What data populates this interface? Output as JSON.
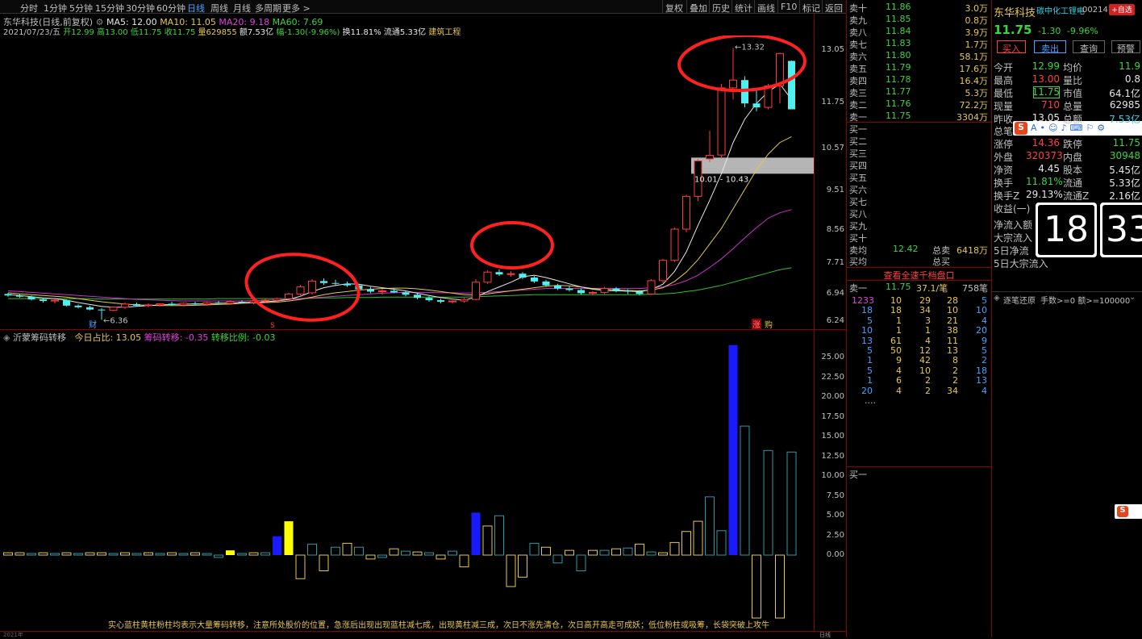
{
  "toolbar": {
    "periods": [
      "分时",
      "1分钟",
      "5分钟",
      "15分钟",
      "30分钟",
      "60分钟",
      "日线",
      "周线",
      "月线",
      "多周期",
      "更多 >"
    ],
    "active_period": "日线",
    "buttons": [
      "复权",
      "叠加",
      "历史",
      "统计",
      "画线",
      "F10",
      "标记",
      "返回"
    ]
  },
  "info": {
    "stock_line": "东华科技(日线,前复权)",
    "ma5": "MA5: 12.00",
    "ma10": "MA10: 11.05",
    "ma20": "MA20: 9.18",
    "ma60": "MA60: 7.69",
    "date": "2021/07/23/五",
    "open": "开12.99",
    "high": "高13.00",
    "low": "低11.75",
    "close": "收11.75",
    "volume": "量629855",
    "amount": "额7.53亿",
    "change": "幅-1.30(-9.96%)",
    "turnover": "换11.81%",
    "float": "流通5.33亿",
    "sector": "建筑工程"
  },
  "kchart": {
    "labels": {
      "high": "13.32",
      "low": "6.36",
      "range": "10.01 - 10.43",
      "cai": "财",
      "s": "S",
      "zhang": "涨",
      "gou": "购"
    },
    "yticks": [
      "13.05",
      "11.75",
      "10.57",
      "9.51",
      "8.56",
      "7.71",
      "6.94",
      "6.24"
    ]
  },
  "indicator": {
    "name": "沂蒙筹码转移",
    "today": "今日占比: 13.05",
    "shift": "筹码转移: -0.35",
    "ratio": "转移比例: -0.03",
    "yticks": [
      "25.00",
      "22.50",
      "20.00",
      "17.50",
      "15.00",
      "12.50",
      "10.00",
      "7.50",
      "5.00",
      "2.50",
      "0.00"
    ],
    "note": "实心蓝柱黄柱粉柱均表示大量筹码转移，注意所处股价的位置，急涨后出现出现蓝柱减七成，出现黄柱减三成，次日不涨先清仓，次日高开高走可成妖；低位粉柱或吸筹，长袋突破上攻牛"
  },
  "bottom_axis": {
    "left": "2021年",
    "right": "日线"
  },
  "orderbook": {
    "sells": [
      {
        "label": "卖十",
        "price": "11.86",
        "vol": "3.0万"
      },
      {
        "label": "卖九",
        "price": "11.85",
        "vol": "0.8万"
      },
      {
        "label": "卖八",
        "price": "11.84",
        "vol": "3.9万"
      },
      {
        "label": "卖七",
        "price": "11.83",
        "vol": "1.7万"
      },
      {
        "label": "卖六",
        "price": "11.80",
        "vol": "58.1万"
      },
      {
        "label": "卖五",
        "price": "11.79",
        "vol": "17.6万"
      },
      {
        "label": "卖四",
        "price": "11.78",
        "vol": "16.4万"
      },
      {
        "label": "卖三",
        "price": "11.77",
        "vol": "5.3万"
      },
      {
        "label": "卖二",
        "price": "11.76",
        "vol": "72.2万"
      },
      {
        "label": "卖一",
        "price": "11.75",
        "vol": "3304万"
      }
    ],
    "buys": [
      "买一",
      "买二",
      "买三",
      "买四",
      "买五",
      "买六",
      "买七",
      "买八",
      "买九",
      "买十"
    ],
    "sell_avg": {
      "label": "卖均",
      "price": "12.42",
      "tlabel": "总卖",
      "total": "6418万"
    },
    "buy_avg": {
      "label": "买均",
      "tlabel": "总买"
    },
    "full_depth": "查看全速千档盘口",
    "queue_header": {
      "label": "卖一",
      "price": "11.75",
      "vol": "37.1/笔",
      "count": "758笔"
    },
    "queue": [
      [
        "1233",
        "10",
        "29",
        "28",
        "5"
      ],
      [
        "18",
        "18",
        "34",
        "10",
        "10"
      ],
      [
        "5",
        "1",
        "3",
        "21",
        "4"
      ],
      [
        "10",
        "1",
        "1",
        "38",
        "20"
      ],
      [
        "13",
        "61",
        "4",
        "11",
        "9"
      ],
      [
        "5",
        "50",
        "12",
        "13",
        "5"
      ],
      [
        "1",
        "9",
        "42",
        "8",
        "2"
      ],
      [
        "5",
        "4",
        "10",
        "2",
        "18"
      ],
      [
        "1",
        "6",
        "2",
        "2",
        "13"
      ],
      [
        "20",
        "4",
        "2",
        "34",
        "4"
      ]
    ],
    "ellipsis": "....",
    "buy1_bottom": "买一"
  },
  "right": {
    "name": "东华科技",
    "sector_tag": "碳中化工锂电",
    "code": "00214",
    "add_btn": "+自选",
    "price": "11.75",
    "change": "-1.30",
    "pct": "-9.96%",
    "buy_btn": "买入",
    "sell_btn": "卖出",
    "query_btn": "查询",
    "alert_btn": "预警",
    "stats": [
      [
        "今开",
        "12.99",
        "均价",
        "11.9"
      ],
      [
        "最高",
        "13.00",
        "量比",
        "0.8"
      ],
      [
        "最低",
        "11.75",
        "市值",
        "64.1亿"
      ],
      [
        "现量",
        "710",
        "总量",
        "62985"
      ],
      [
        "昨收",
        "13.05",
        "总额",
        "7.53亿"
      ]
    ],
    "stats2": [
      [
        "涨停",
        "14.36",
        "跌停",
        "11.75"
      ],
      [
        "外盘",
        "320373",
        "内盘",
        "30948"
      ],
      [
        "净资",
        "4.45",
        "股本",
        "5.45亿"
      ],
      [
        "换手",
        "11.81%",
        "流通",
        "5.33亿"
      ],
      [
        "换手Z",
        "29.13%",
        "流通Z",
        "2.16亿"
      ],
      [
        "收益(一)",
        "",
        ""
      ]
    ],
    "flow": [
      "净流入额",
      "大宗流入",
      "5日净流",
      "5日大宗流入"
    ],
    "total_bi_label": "总笔",
    "clock_h": "18",
    "clock_m": "33",
    "trade_header": "逐笔还原",
    "trade_filter": "手数>=0 额>=100000"
  },
  "chart_data": {
    "type": "candlestick",
    "ylim_price": [
      6.2,
      13.6
    ],
    "candles": [
      [
        7.02,
        7.05,
        6.95,
        6.98
      ],
      [
        6.98,
        7.02,
        6.92,
        6.95
      ],
      [
        6.95,
        6.98,
        6.85,
        6.88
      ],
      [
        6.88,
        6.92,
        6.8,
        6.84
      ],
      [
        6.84,
        6.9,
        6.78,
        6.86
      ],
      [
        6.86,
        6.88,
        6.7,
        6.72
      ],
      [
        6.72,
        6.75,
        6.65,
        6.68
      ],
      [
        6.68,
        6.72,
        6.6,
        6.62
      ],
      [
        6.62,
        6.66,
        6.36,
        6.6
      ],
      [
        6.6,
        6.7,
        6.58,
        6.68
      ],
      [
        6.68,
        6.8,
        6.64,
        6.76
      ],
      [
        6.76,
        6.8,
        6.7,
        6.72
      ],
      [
        6.72,
        6.78,
        6.68,
        6.74
      ],
      [
        6.74,
        6.78,
        6.7,
        6.77
      ],
      [
        6.77,
        6.82,
        6.72,
        6.74
      ],
      [
        6.74,
        6.8,
        6.7,
        6.78
      ],
      [
        6.78,
        6.82,
        6.74,
        6.76
      ],
      [
        6.76,
        6.82,
        6.72,
        6.8
      ],
      [
        6.8,
        6.84,
        6.76,
        6.78
      ],
      [
        6.78,
        6.86,
        6.74,
        6.82
      ],
      [
        6.82,
        6.86,
        6.78,
        6.8
      ],
      [
        6.8,
        6.86,
        6.76,
        6.84
      ],
      [
        6.84,
        6.9,
        6.8,
        6.86
      ],
      [
        6.86,
        6.92,
        6.82,
        6.9
      ],
      [
        6.9,
        7.05,
        6.88,
        7.02
      ],
      [
        7.02,
        7.25,
        6.98,
        7.2
      ],
      [
        7.05,
        7.4,
        7.0,
        7.35
      ],
      [
        7.35,
        7.42,
        7.25,
        7.3
      ],
      [
        7.3,
        7.38,
        7.22,
        7.28
      ],
      [
        7.28,
        7.34,
        7.2,
        7.24
      ],
      [
        7.24,
        7.28,
        7.1,
        7.14
      ],
      [
        7.14,
        7.2,
        7.04,
        7.08
      ],
      [
        7.08,
        7.14,
        7.0,
        7.1
      ],
      [
        7.1,
        7.16,
        7.04,
        7.06
      ],
      [
        7.06,
        7.1,
        6.96,
        7.0
      ],
      [
        7.0,
        7.04,
        6.88,
        6.92
      ],
      [
        6.92,
        6.96,
        6.82,
        6.86
      ],
      [
        6.86,
        6.9,
        6.78,
        6.82
      ],
      [
        6.82,
        6.86,
        6.78,
        6.84
      ],
      [
        6.84,
        6.92,
        6.8,
        6.88
      ],
      [
        6.88,
        7.4,
        6.86,
        7.32
      ],
      [
        7.32,
        7.62,
        7.28,
        7.58
      ],
      [
        7.58,
        7.65,
        7.48,
        7.52
      ],
      [
        7.52,
        7.6,
        7.46,
        7.54
      ],
      [
        7.54,
        7.58,
        7.4,
        7.44
      ],
      [
        7.44,
        7.48,
        7.3,
        7.34
      ],
      [
        7.34,
        7.38,
        7.2,
        7.24
      ],
      [
        7.24,
        7.28,
        7.12,
        7.16
      ],
      [
        7.16,
        7.22,
        7.08,
        7.12
      ],
      [
        7.12,
        7.16,
        7.0,
        7.04
      ],
      [
        7.04,
        7.1,
        6.98,
        7.06
      ],
      [
        7.06,
        7.2,
        7.02,
        7.16
      ],
      [
        7.16,
        7.2,
        7.06,
        7.1
      ],
      [
        7.1,
        7.14,
        7.02,
        7.08
      ],
      [
        7.08,
        7.12,
        6.98,
        7.02
      ],
      [
        7.02,
        7.4,
        7.0,
        7.36
      ],
      [
        7.36,
        7.92,
        7.3,
        7.88
      ],
      [
        7.88,
        8.72,
        7.84,
        8.68
      ],
      [
        8.68,
        9.56,
        8.6,
        9.52
      ],
      [
        9.52,
        10.48,
        9.4,
        10.43
      ],
      [
        10.48,
        11.2,
        10.4,
        10.57
      ],
      [
        10.58,
        12.4,
        10.5,
        12.3
      ],
      [
        12.3,
        13.32,
        12.0,
        12.5
      ],
      [
        12.5,
        12.6,
        11.8,
        11.9
      ],
      [
        11.9,
        12.3,
        11.7,
        11.8
      ],
      [
        11.8,
        12.4,
        11.75,
        12.35
      ],
      [
        12.35,
        13.2,
        11.9,
        13.18
      ],
      [
        12.99,
        13.0,
        11.75,
        11.75
      ]
    ],
    "ma5": [
      7.0,
      6.98,
      6.95,
      6.92,
      6.9,
      6.86,
      6.8,
      6.75,
      6.7,
      6.68,
      6.68,
      6.7,
      6.72,
      6.74,
      6.75,
      6.76,
      6.76,
      6.77,
      6.78,
      6.79,
      6.8,
      6.81,
      6.82,
      6.84,
      6.88,
      6.96,
      7.08,
      7.18,
      7.24,
      7.28,
      7.27,
      7.22,
      7.18,
      7.14,
      7.1,
      7.04,
      6.98,
      6.93,
      6.89,
      6.86,
      6.94,
      7.08,
      7.2,
      7.32,
      7.46,
      7.5,
      7.44,
      7.36,
      7.28,
      7.2,
      7.14,
      7.11,
      7.1,
      7.09,
      7.08,
      7.13,
      7.27,
      7.6,
      8.1,
      8.78,
      9.42,
      10.1,
      10.9,
      11.5,
      11.9,
      12.2,
      12.4,
      12.0
    ],
    "ma10": [
      7.05,
      7.02,
      7.0,
      6.98,
      6.96,
      6.94,
      6.9,
      6.86,
      6.82,
      6.79,
      6.76,
      6.74,
      6.73,
      6.72,
      6.72,
      6.72,
      6.73,
      6.74,
      6.75,
      6.76,
      6.78,
      6.79,
      6.8,
      6.81,
      6.84,
      6.88,
      6.94,
      7.0,
      7.05,
      7.08,
      7.12,
      7.14,
      7.16,
      7.17,
      7.17,
      7.15,
      7.12,
      7.08,
      7.04,
      7.0,
      6.99,
      7.02,
      7.06,
      7.1,
      7.14,
      7.18,
      7.22,
      7.24,
      7.23,
      7.2,
      7.16,
      7.14,
      7.12,
      7.11,
      7.1,
      7.12,
      7.18,
      7.34,
      7.58,
      7.9,
      8.3,
      8.7,
      9.2,
      9.7,
      10.2,
      10.6,
      10.9,
      11.05
    ],
    "ma20": [
      7.1,
      7.08,
      7.06,
      7.04,
      7.02,
      7.0,
      6.98,
      6.96,
      6.94,
      6.92,
      6.9,
      6.88,
      6.87,
      6.86,
      6.85,
      6.84,
      6.84,
      6.84,
      6.84,
      6.84,
      6.84,
      6.85,
      6.86,
      6.87,
      6.88,
      6.9,
      6.92,
      6.94,
      6.96,
      6.98,
      7.0,
      7.02,
      7.04,
      7.05,
      7.06,
      7.06,
      7.06,
      7.05,
      7.05,
      7.04,
      7.05,
      7.06,
      7.08,
      7.1,
      7.12,
      7.14,
      7.16,
      7.16,
      7.16,
      7.16,
      7.16,
      7.16,
      7.16,
      7.16,
      7.16,
      7.18,
      7.2,
      7.26,
      7.36,
      7.5,
      7.7,
      7.92,
      8.18,
      8.46,
      8.72,
      8.96,
      9.1,
      9.18
    ],
    "ma60": [
      6.9,
      6.9,
      6.9,
      6.9,
      6.9,
      6.9,
      6.9,
      6.9,
      6.89,
      6.89,
      6.89,
      6.89,
      6.89,
      6.89,
      6.89,
      6.89,
      6.89,
      6.89,
      6.9,
      6.9,
      6.9,
      6.9,
      6.9,
      6.9,
      6.9,
      6.9,
      6.91,
      6.92,
      6.92,
      6.93,
      6.93,
      6.93,
      6.94,
      6.94,
      6.94,
      6.94,
      6.94,
      6.94,
      6.94,
      6.94,
      6.95,
      6.96,
      6.97,
      6.98,
      6.99,
      7.0,
      7.0,
      7.0,
      7.0,
      7.0,
      7.0,
      7.0,
      7.0,
      7.0,
      7.0,
      7.01,
      7.02,
      7.04,
      7.08,
      7.12,
      7.18,
      7.24,
      7.32,
      7.4,
      7.48,
      7.56,
      7.64,
      7.69
    ],
    "indicator_bars": [
      {
        "v": 0.3,
        "c": "y"
      },
      {
        "v": 0.3,
        "c": "y"
      },
      {
        "v": 0.2,
        "c": "o"
      },
      {
        "v": 0.3,
        "c": "y"
      },
      {
        "v": 0.2,
        "c": "o"
      },
      {
        "v": 0.3,
        "c": "y"
      },
      {
        "v": 0.2,
        "c": "o"
      },
      {
        "v": 0.3,
        "c": "y"
      },
      {
        "v": 0.3,
        "c": "y"
      },
      {
        "v": 0.2,
        "c": "o"
      },
      {
        "v": 0.3,
        "c": "y"
      },
      {
        "v": 0.2,
        "c": "o"
      },
      {
        "v": 0.3,
        "c": "y"
      },
      {
        "v": 0.2,
        "c": "o"
      },
      {
        "v": 0.3,
        "c": "y"
      },
      {
        "v": 0.2,
        "c": "o"
      },
      {
        "v": 0.3,
        "c": "y"
      },
      {
        "v": 0.2,
        "c": "o"
      },
      {
        "v": -0.3,
        "c": "o"
      },
      {
        "v": 0.6,
        "c": "fy"
      },
      {
        "v": 0.2,
        "c": "o"
      },
      {
        "v": 0.3,
        "c": "y"
      },
      {
        "v": 0.3,
        "c": "o"
      },
      {
        "v": 2.4,
        "c": "fb"
      },
      {
        "v": 4.3,
        "c": "fy"
      },
      {
        "v": -3.0,
        "c": "y"
      },
      {
        "v": 1.4,
        "c": "o"
      },
      {
        "v": -2.0,
        "c": "y"
      },
      {
        "v": 1.0,
        "c": "o"
      },
      {
        "v": 1.5,
        "c": "y"
      },
      {
        "v": 1.0,
        "c": "o"
      },
      {
        "v": -0.5,
        "c": "y"
      },
      {
        "v": -0.3,
        "c": "o"
      },
      {
        "v": 0.8,
        "c": "y"
      },
      {
        "v": 0.5,
        "c": "o"
      },
      {
        "v": 0.4,
        "c": "y"
      },
      {
        "v": 0.3,
        "c": "o"
      },
      {
        "v": -0.5,
        "c": "y"
      },
      {
        "v": 0.5,
        "c": "o"
      },
      {
        "v": -1.5,
        "c": "y"
      },
      {
        "v": 5.4,
        "c": "fb"
      },
      {
        "v": 3.7,
        "c": "y"
      },
      {
        "v": 5.0,
        "c": "o"
      },
      {
        "v": -4.0,
        "c": "y"
      },
      {
        "v": -2.8,
        "c": "y"
      },
      {
        "v": 1.5,
        "c": "o"
      },
      {
        "v": 1.0,
        "c": "y"
      },
      {
        "v": -1.0,
        "c": "o"
      },
      {
        "v": 0.6,
        "c": "y"
      },
      {
        "v": -2.0,
        "c": "o"
      },
      {
        "v": 0.6,
        "c": "y"
      },
      {
        "v": 0.6,
        "c": "o"
      },
      {
        "v": 0.8,
        "c": "y"
      },
      {
        "v": 0.9,
        "c": "o"
      },
      {
        "v": 1.4,
        "c": "y"
      },
      {
        "v": 0.4,
        "c": "o"
      },
      {
        "v": 0.3,
        "c": "y"
      },
      {
        "v": 1.6,
        "c": "y"
      },
      {
        "v": 3.0,
        "c": "y"
      },
      {
        "v": 4.3,
        "c": "y"
      },
      {
        "v": 7.4,
        "c": "o"
      },
      {
        "v": 3.1,
        "c": "o"
      },
      {
        "v": 26.7,
        "c": "fb"
      },
      {
        "v": 16.4,
        "c": "o"
      },
      {
        "v": -8.0,
        "c": "y"
      },
      {
        "v": 13.3,
        "c": "o"
      },
      {
        "v": -8.0,
        "c": "y"
      },
      {
        "v": 13.1,
        "c": "o"
      }
    ]
  }
}
